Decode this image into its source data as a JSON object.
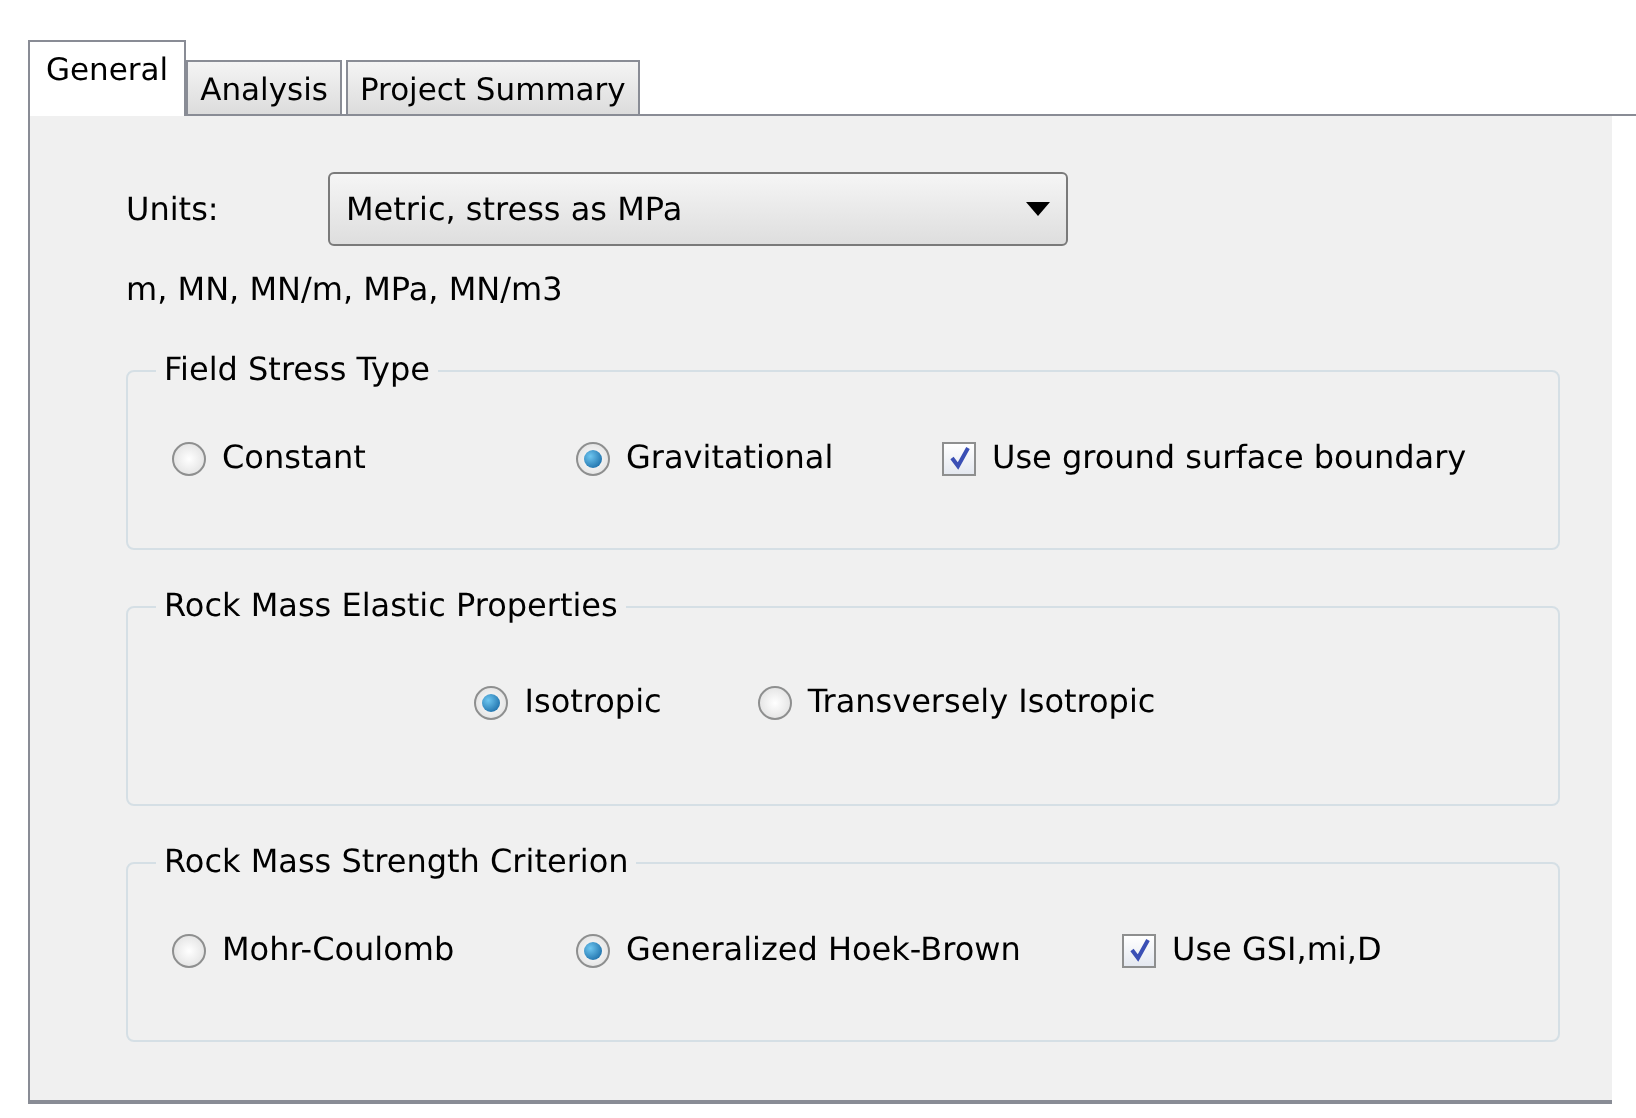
{
  "tabs": [
    {
      "label": "General",
      "selected": true
    },
    {
      "label": "Analysis",
      "selected": false
    },
    {
      "label": "Project Summary",
      "selected": false
    }
  ],
  "units": {
    "label": "Units:",
    "value": "Metric, stress as MPa",
    "note": "m, MN, MN/m, MPa, MN/m3"
  },
  "groups": [
    {
      "title": "Field Stress Type",
      "options": [
        {
          "kind": "radio",
          "label": "Constant",
          "selected": false
        },
        {
          "kind": "radio",
          "label": "Gravitational",
          "selected": true
        },
        {
          "kind": "checkbox",
          "label": "Use ground surface boundary",
          "checked": true
        }
      ]
    },
    {
      "title": "Rock Mass Elastic Properties",
      "options": [
        {
          "kind": "radio",
          "label": "Isotropic",
          "selected": true
        },
        {
          "kind": "radio",
          "label": "Transversely Isotropic",
          "selected": false
        }
      ]
    },
    {
      "title": "Rock Mass Strength Criterion",
      "options": [
        {
          "kind": "radio",
          "label": "Mohr-Coulomb",
          "selected": false
        },
        {
          "kind": "radio",
          "label": "Generalized Hoek-Brown",
          "selected": true
        },
        {
          "kind": "checkbox",
          "label": "Use GSI,mi,D",
          "checked": true
        }
      ]
    }
  ]
}
